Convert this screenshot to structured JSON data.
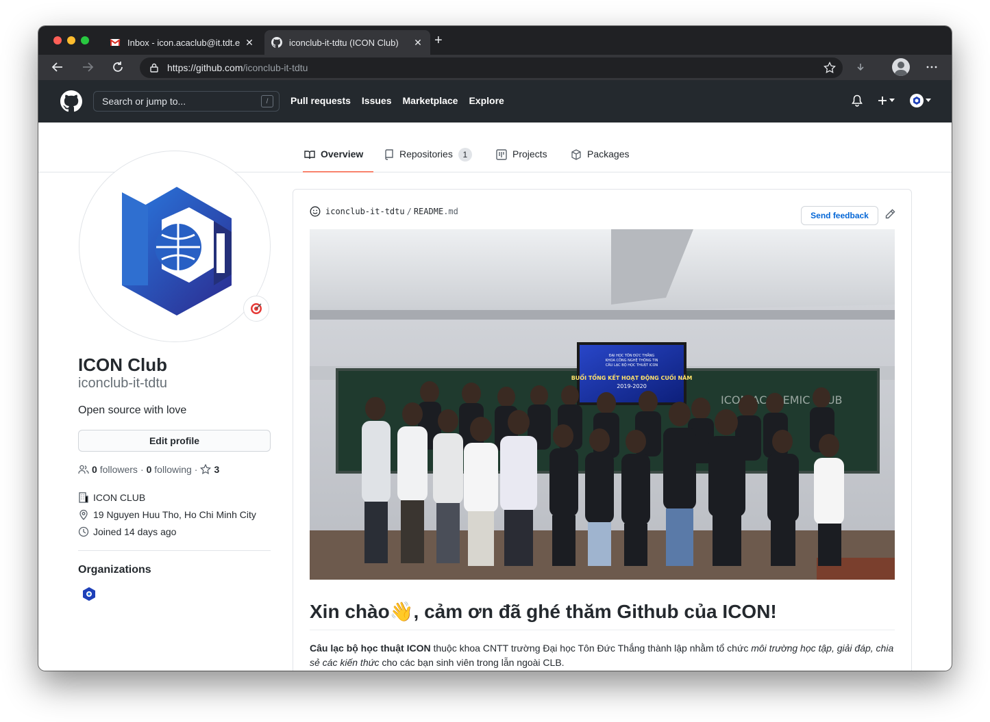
{
  "browser": {
    "tabs": [
      {
        "title": "Inbox - icon.acaclub@it.tdt.edu.vn",
        "favicon": "gmail-icon",
        "active": false
      },
      {
        "title": "iconclub-it-tdtu (ICON Club)",
        "favicon": "github-icon",
        "active": true
      }
    ],
    "url_scheme_host": "https://github.com",
    "url_path": "/iconclub-it-tdtu"
  },
  "header": {
    "search_placeholder": "Search or jump to...",
    "search_shortcut": "/",
    "nav": [
      "Pull requests",
      "Issues",
      "Marketplace",
      "Explore"
    ]
  },
  "profile_tabs": {
    "overview": "Overview",
    "repositories": "Repositories",
    "repositories_count": "1",
    "projects": "Projects",
    "packages": "Packages"
  },
  "profile": {
    "name": "ICON Club",
    "login": "iconclub-it-tdtu",
    "bio": "Open source with love",
    "edit_label": "Edit profile",
    "followers_count": "0",
    "followers_label": "followers",
    "following_count": "0",
    "following_label": "following",
    "stars_count": "3",
    "company": "ICON CLUB",
    "location": "19 Nguyen Huu Tho, Ho Chi Minh City",
    "joined": "Joined 14 days ago",
    "organizations_title": "Organizations"
  },
  "readme": {
    "owner": "iconclub-it-tdtu",
    "separator": "/",
    "file_name": "README",
    "file_ext": ".md",
    "feedback_label": "Send feedback",
    "banner_line1": "ĐẠI HỌC TÔN ĐỨC THẮNG",
    "banner_line2": "KHOA CÔNG NGHỆ THÔNG TIN",
    "banner_line3": "CÂU LẠC BỘ HỌC THUẬT ICON",
    "banner_title": "BUỔI TỔNG KẾT HOẠT ĐỘNG CUỐI NĂM",
    "banner_year": "2019-2020",
    "board_text": "ICON ACADEMIC CLUB",
    "heading": "Xin chào👋, cảm ơn đã ghé thăm Github của ICON!",
    "para_bold": "Câu lạc bộ học thuật ICON",
    "para_text1": " thuộc khoa CNTT trường Đại học Tôn Đức Thắng thành lập nhằm tổ chức ",
    "para_italic": "môi trường học tập, giải đáp, chia sẻ các kiến thức",
    "para_text2": " cho các bạn sinh viên trong lẫn ngoài CLB."
  },
  "colors": {
    "header_bg": "#24292e",
    "tab_underline": "#f9826c",
    "link": "#0366d6",
    "logo_blue": "#1e40b8"
  }
}
